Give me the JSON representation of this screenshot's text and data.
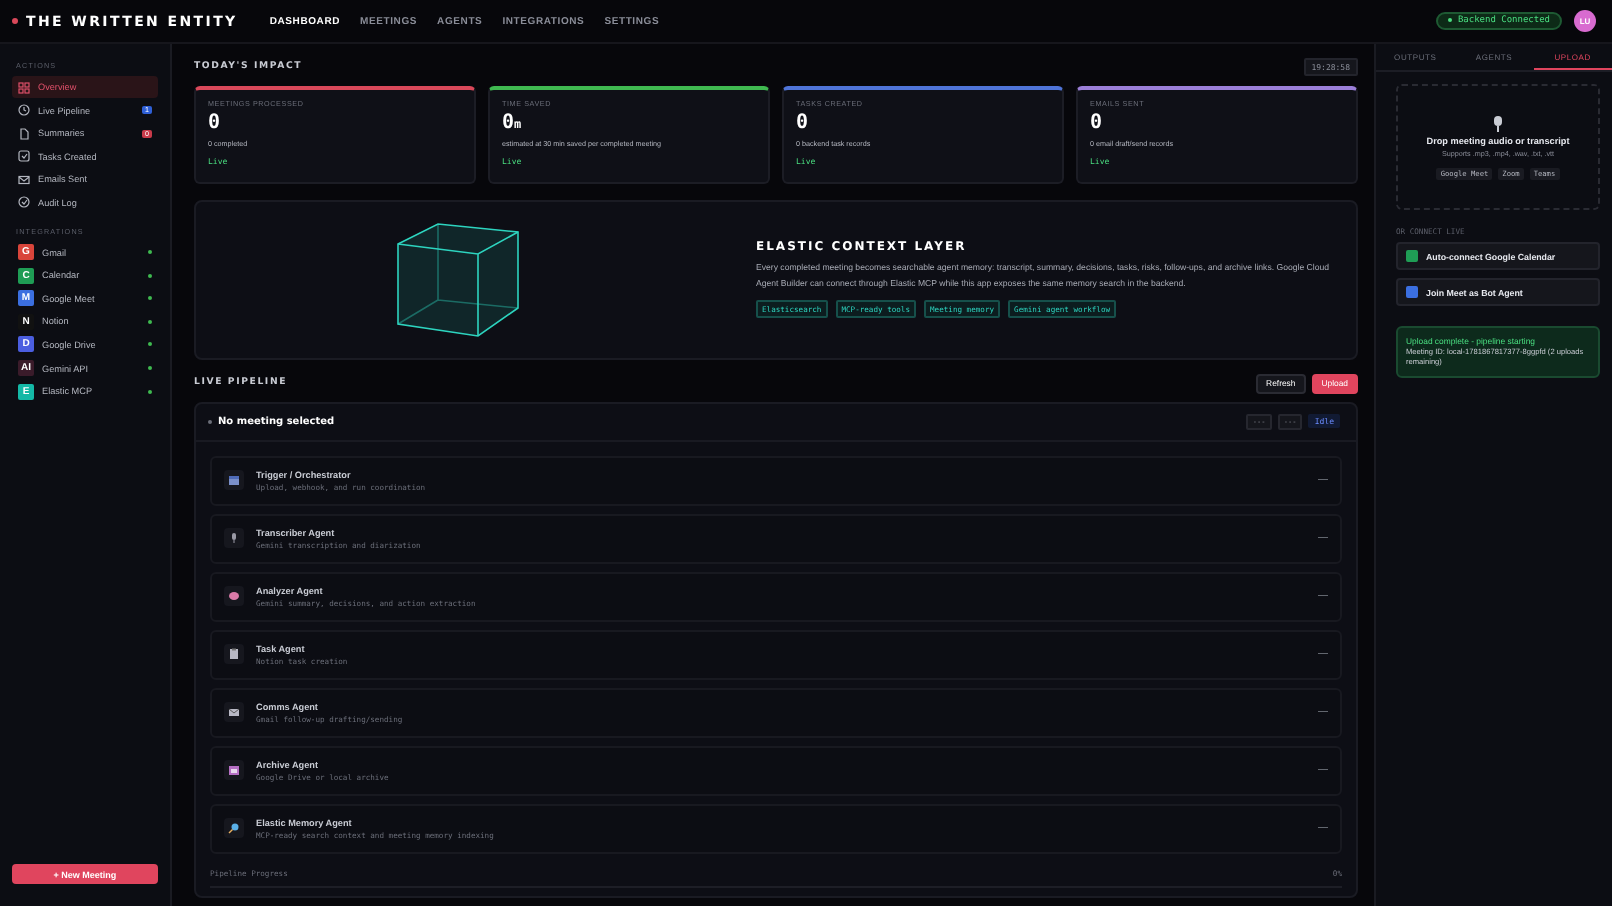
{
  "brand": "THE WRITTEN ENTITY",
  "nav": [
    {
      "label": "DASHBOARD",
      "selected": true
    },
    {
      "label": "MEETINGS",
      "selected": false
    },
    {
      "label": "AGENTS",
      "selected": false
    },
    {
      "label": "INTEGRATIONS",
      "selected": false
    },
    {
      "label": "SETTINGS",
      "selected": false
    }
  ],
  "backend_status": "Backend Connected",
  "avatar": "LU",
  "sidebar": {
    "actions_title": "ACTIONS",
    "actions": [
      {
        "label": "Overview",
        "selected": true
      },
      {
        "label": "Live Pipeline",
        "selected": false,
        "badge": "1",
        "color": "#2f5fd6"
      },
      {
        "label": "Summaries",
        "selected": false,
        "badge": "0",
        "color": "#c93a4a"
      },
      {
        "label": "Tasks Created",
        "selected": false
      },
      {
        "label": "Emails Sent",
        "selected": false
      },
      {
        "label": "Audit Log",
        "selected": false
      }
    ],
    "integrations_title": "INTEGRATIONS",
    "integrations": [
      {
        "label": "Gmail",
        "glyph": "G",
        "color": "#d9453b"
      },
      {
        "label": "Calendar",
        "glyph": "C",
        "color": "#1f9d55"
      },
      {
        "label": "Google Meet",
        "glyph": "M",
        "color": "#3b6fe0"
      },
      {
        "label": "Notion",
        "glyph": "N",
        "color": "#111111"
      },
      {
        "label": "Google Drive",
        "glyph": "D",
        "color": "#4b5ee0"
      },
      {
        "label": "Gemini API",
        "glyph": "AI",
        "color": "#3a1b2a"
      },
      {
        "label": "Elastic MCP",
        "glyph": "E",
        "color": "#14b8a6"
      }
    ],
    "new_meeting": "+ New Meeting"
  },
  "impact": {
    "title": "TODAY'S IMPACT",
    "time": "19:28:58",
    "cards": [
      {
        "label": "MEETINGS PROCESSED",
        "value": "0",
        "note": "0 completed",
        "status": "Live",
        "color": "#d9485a"
      },
      {
        "label": "TIME SAVED",
        "value": "0",
        "unit": "m",
        "note": "estimated at 30 min saved per completed meeting",
        "status": "Live",
        "color": "#3fb950"
      },
      {
        "label": "TASKS CREATED",
        "value": "0",
        "note": "0 backend task records",
        "status": "Live",
        "color": "#4f74d8"
      },
      {
        "label": "EMAILS SENT",
        "value": "0",
        "note": "0 email draft/send records",
        "status": "Live",
        "color": "#9b7fd8"
      }
    ]
  },
  "elastic": {
    "title": "ELASTIC CONTEXT LAYER",
    "text": "Every completed meeting becomes searchable agent memory: transcript, summary, decisions, tasks, risks, follow-ups, and archive links. Google Cloud Agent Builder can connect through Elastic MCP while this app exposes the same memory search in the backend.",
    "tags": [
      "Elasticsearch",
      "MCP-ready tools",
      "Meeting memory",
      "Gemini agent workflow"
    ]
  },
  "pipeline": {
    "title": "LIVE PIPELINE",
    "refresh": "Refresh",
    "upload": "Upload",
    "meeting": "No meeting selected",
    "chip_1": "---",
    "chip_2": "---",
    "state": "Idle",
    "agents": [
      {
        "name": "Trigger / Orchestrator",
        "desc": "Upload, webhook, and run coordination",
        "status": "—"
      },
      {
        "name": "Transcriber Agent",
        "desc": "Gemini transcription and diarization",
        "status": "—"
      },
      {
        "name": "Analyzer Agent",
        "desc": "Gemini summary, decisions, and action extraction",
        "status": "—"
      },
      {
        "name": "Task Agent",
        "desc": "Notion task creation",
        "status": "—"
      },
      {
        "name": "Comms Agent",
        "desc": "Gmail follow-up drafting/sending",
        "status": "—"
      },
      {
        "name": "Archive Agent",
        "desc": "Google Drive or local archive",
        "status": "—"
      },
      {
        "name": "Elastic Memory Agent",
        "desc": "MCP-ready search context and meeting memory indexing",
        "status": "—"
      }
    ],
    "progress_label": "Pipeline Progress",
    "progress": "0%"
  },
  "right": {
    "tabs": [
      {
        "label": "OUTPUTS",
        "selected": false
      },
      {
        "label": "AGENTS",
        "selected": false
      },
      {
        "label": "UPLOAD",
        "selected": true
      }
    ],
    "drop_title": "Drop meeting audio or transcript",
    "drop_hint": "Supports .mp3, .mp4, .wav, .txt, .vtt",
    "sources": [
      "Google Meet",
      "Zoom",
      "Teams"
    ],
    "connect_title": "OR CONNECT LIVE",
    "connect": [
      {
        "label": "Auto-connect Google Calendar",
        "color": "#1f9d55"
      },
      {
        "label": "Join Meet as Bot Agent",
        "color": "#3b6fe0"
      }
    ],
    "notice_title": "Upload complete - pipeline starting",
    "notice_text": "Meeting ID: local-1781867817377-8ggpfd (2 uploads remaining)"
  }
}
